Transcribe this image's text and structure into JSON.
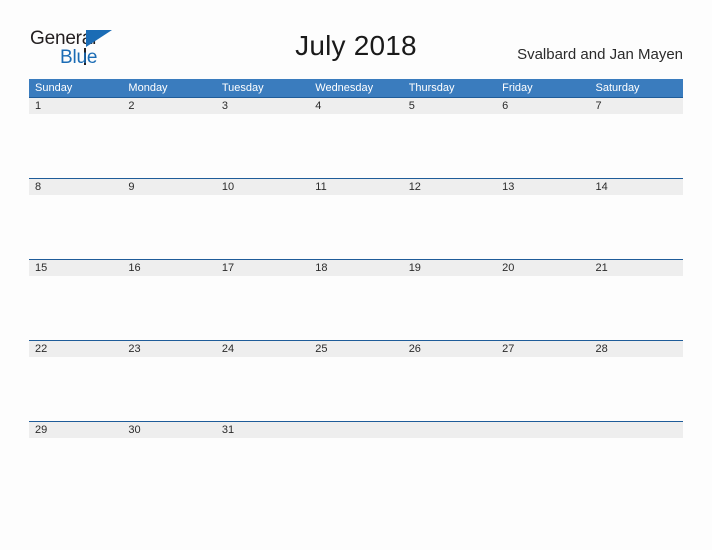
{
  "brand": {
    "line1": "General",
    "line2": "Blue",
    "accent_color": "#1b6cb5",
    "triangle_icon": "triangle-icon"
  },
  "header": {
    "title": "July 2018",
    "subtitle": "Svalbard and Jan Mayen"
  },
  "calendar": {
    "header_bg": "#3a7cbe",
    "row_separator_color": "#1f5c99",
    "date_band_bg": "#eeeeee",
    "weekdays": [
      "Sunday",
      "Monday",
      "Tuesday",
      "Wednesday",
      "Thursday",
      "Friday",
      "Saturday"
    ],
    "weeks": [
      {
        "days": [
          "1",
          "2",
          "3",
          "4",
          "5",
          "6",
          "7"
        ]
      },
      {
        "days": [
          "8",
          "9",
          "10",
          "11",
          "12",
          "13",
          "14"
        ]
      },
      {
        "days": [
          "15",
          "16",
          "17",
          "18",
          "19",
          "20",
          "21"
        ]
      },
      {
        "days": [
          "22",
          "23",
          "24",
          "25",
          "26",
          "27",
          "28"
        ]
      },
      {
        "days": [
          "29",
          "30",
          "31",
          "",
          "",
          "",
          ""
        ]
      }
    ]
  }
}
